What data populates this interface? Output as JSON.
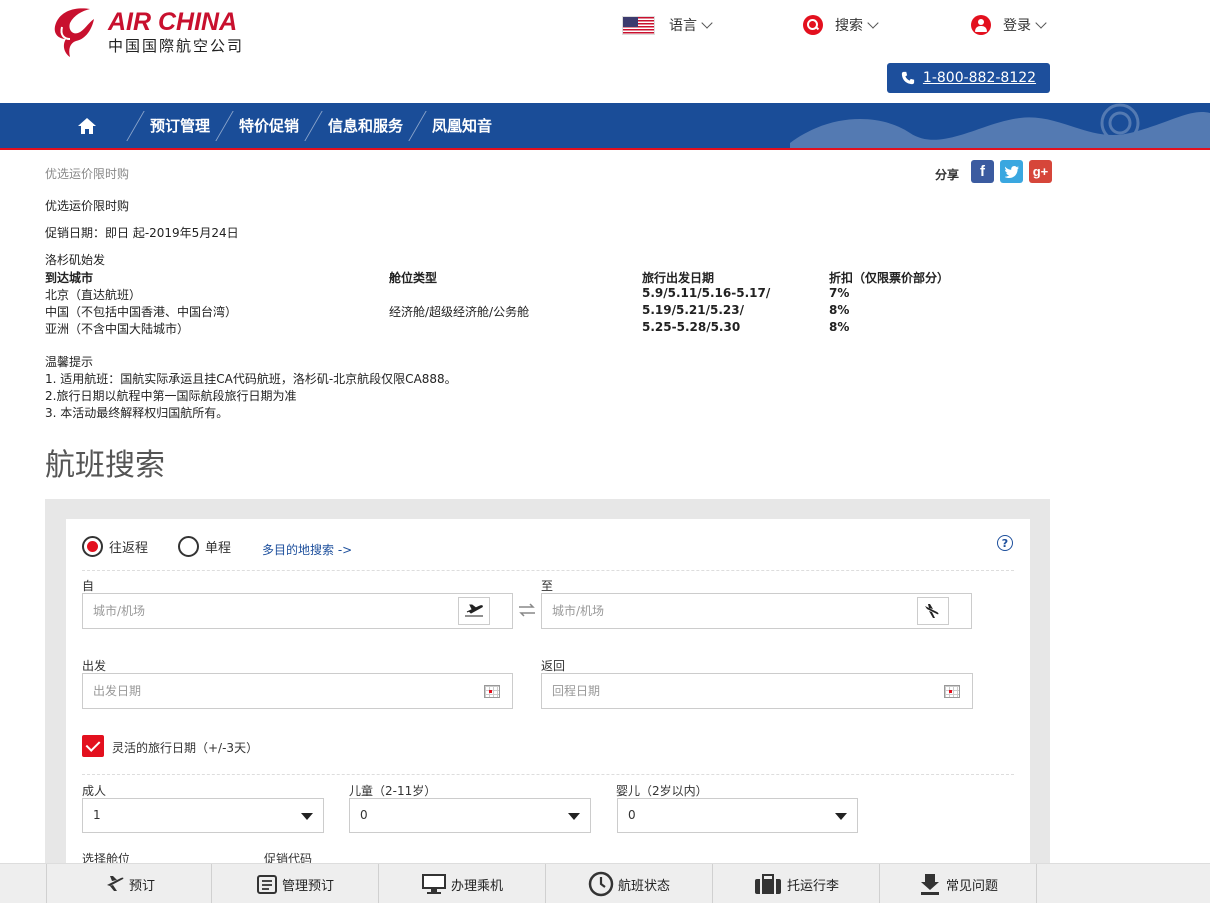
{
  "brand": {
    "name_en": "AIR CHINA",
    "name_cn": "中国国際航空公司"
  },
  "top": {
    "language_label": "语言",
    "search_label": "搜索",
    "login_label": "登录",
    "phone": "1-800-882-8122"
  },
  "nav": {
    "items": [
      "预订管理",
      "特价促销",
      "信息和服务",
      "凤凰知音"
    ]
  },
  "breadcrumb": "优选运价限时购",
  "share": {
    "label": "分享"
  },
  "promo": {
    "title": "优选运价限时购",
    "date_line": "促销日期：即日 起-2019年5月24日",
    "origin": "洛杉矶始发",
    "headers": [
      "到达城市",
      "舱位类型",
      "旅行出发日期",
      "折扣（仅限票价部分）"
    ],
    "rows": [
      {
        "city": "北京（直达航班）",
        "cabin": "",
        "dates": "5.9/5.11/5.16-5.17/",
        "discount": "7%"
      },
      {
        "city": "中国（不包括中国香港、中国台湾）",
        "cabin": "经济舱/超级经济舱/公务舱",
        "dates": "5.19/5.21/5.23/",
        "discount": "8%"
      },
      {
        "city": "亚洲（不含中国大陆城市）",
        "cabin": "",
        "dates": "5.25-5.28/5.30",
        "discount": "8%"
      }
    ],
    "notes_title": "温馨提示",
    "notes": [
      "1. 适用航班：国航实际承运且挂CA代码航班，洛杉矶-北京航段仅限CA888。",
      "2.旅行日期以航程中第一国际航段旅行日期为准",
      "3. 本活动最终解释权归国航所有。"
    ]
  },
  "search": {
    "title": "航班搜索",
    "trip_round": "往返程",
    "trip_oneway": "单程",
    "multi_link": "多目的地搜索 ->",
    "help": "?",
    "from_label": "自",
    "to_label": "至",
    "from_placeholder": "城市/机场",
    "to_placeholder": "城市/机场",
    "depart_label": "出发",
    "return_label": "返回",
    "depart_placeholder": "出发日期",
    "return_placeholder": "回程日期",
    "flexible_label": "灵活的旅行日期（+/-3天）",
    "adult_label": "成人",
    "child_label": "儿童（2-11岁）",
    "infant_label": "婴儿（2岁以内）",
    "adult_value": "1",
    "child_value": "0",
    "infant_value": "0",
    "cabin_label": "选择舱位",
    "promo_label": "促销代码"
  },
  "bottombar": {
    "items": [
      "预订",
      "管理预订",
      "办理乘机",
      "航班状态",
      "托运行李",
      "常见问题"
    ]
  },
  "colors": {
    "brand_blue": "#1a4d98",
    "brand_red": "#e3101e"
  }
}
